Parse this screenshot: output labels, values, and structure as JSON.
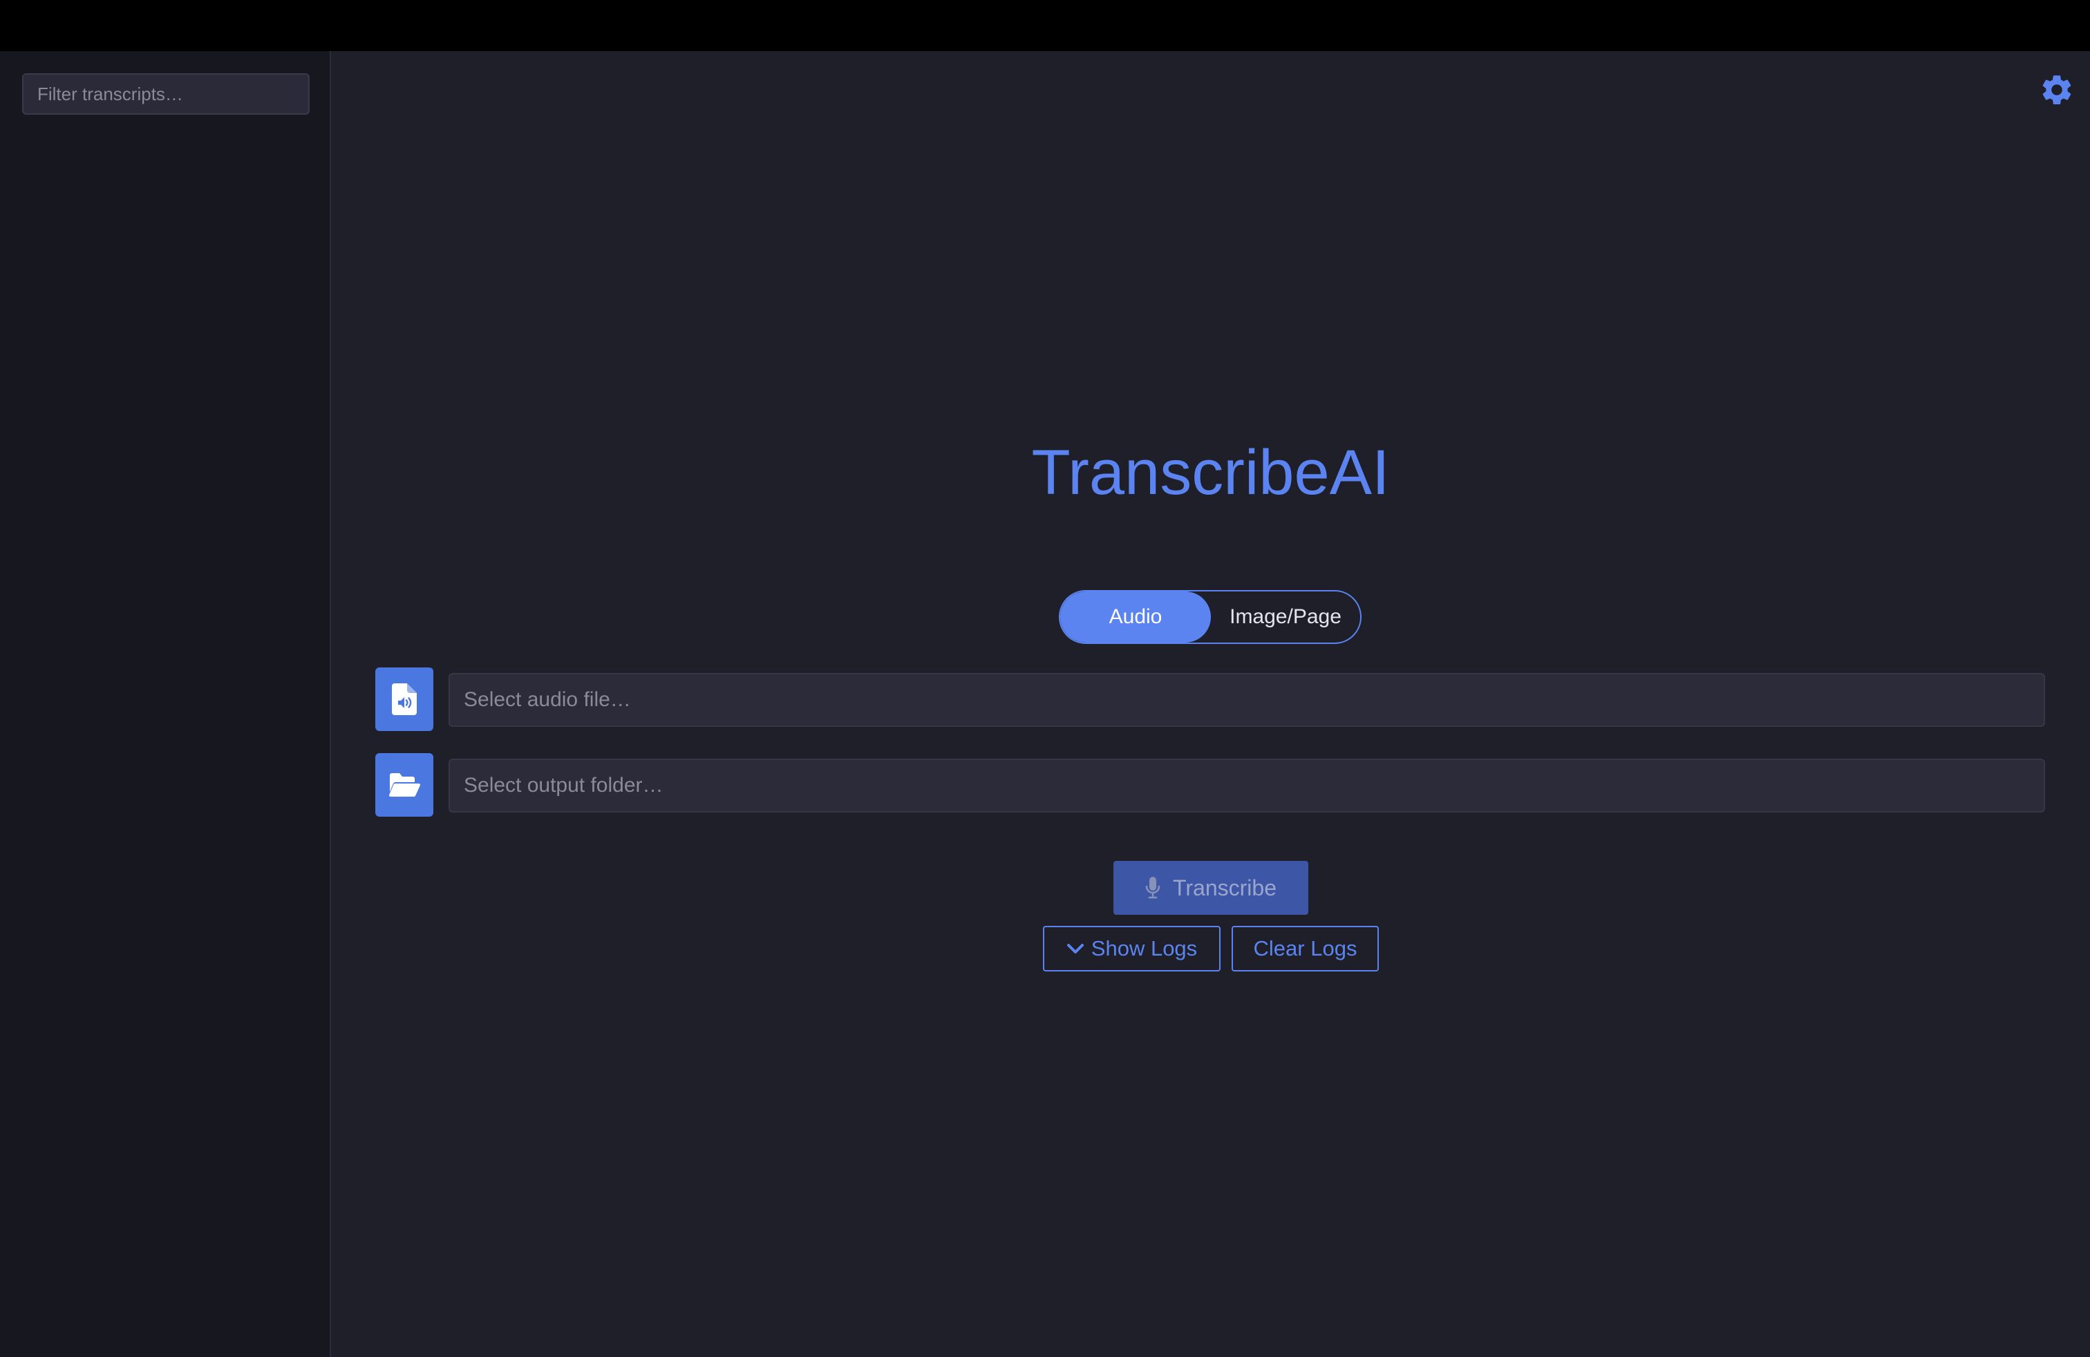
{
  "sidebar": {
    "filter_placeholder": "Filter transcripts…"
  },
  "header": {
    "settings_icon": "gear-icon"
  },
  "main": {
    "title": "TranscribeAI",
    "mode_toggle": {
      "options": [
        "Audio",
        "Image/Page"
      ],
      "selected": "Audio"
    },
    "audio_file": {
      "icon": "audio-file-icon",
      "placeholder": "Select audio file…",
      "value": ""
    },
    "output_folder": {
      "icon": "folder-open-icon",
      "placeholder": "Select output folder…",
      "value": ""
    },
    "transcribe_button": {
      "label": "Transcribe",
      "icon": "microphone-icon",
      "disabled": true
    },
    "show_logs_button": {
      "label": "Show Logs",
      "icon": "chevron-down-icon"
    },
    "clear_logs_button": {
      "label": "Clear Logs"
    }
  },
  "colors": {
    "accent": "#5b84f0",
    "background": "#1f1f2a",
    "sidebar_background": "#17171f",
    "topbar": "#000000"
  }
}
